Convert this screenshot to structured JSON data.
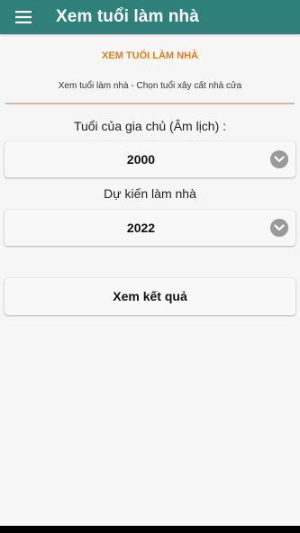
{
  "app_bar": {
    "title": "Xem tuổi làm nhà",
    "menu_icon": "hamburger-menu-icon",
    "background_color": "#2f7f7a"
  },
  "content": {
    "section_title": "XEM TUỔI LÀM NHÀ",
    "section_title_color": "#e07d1a",
    "subtitle": "Xem tuổi làm nhà - Chọn tuổi xây cất nhà cửa",
    "owner_age": {
      "label": "Tuổi của gia chủ (Âm lịch) :",
      "selected_value": "2000",
      "dropdown_icon": "chevron-down-icon"
    },
    "build_year": {
      "label": "Dự kiến làm nhà",
      "selected_value": "2022",
      "dropdown_icon": "chevron-down-icon"
    },
    "result_button_label": "Xem kết quả"
  }
}
